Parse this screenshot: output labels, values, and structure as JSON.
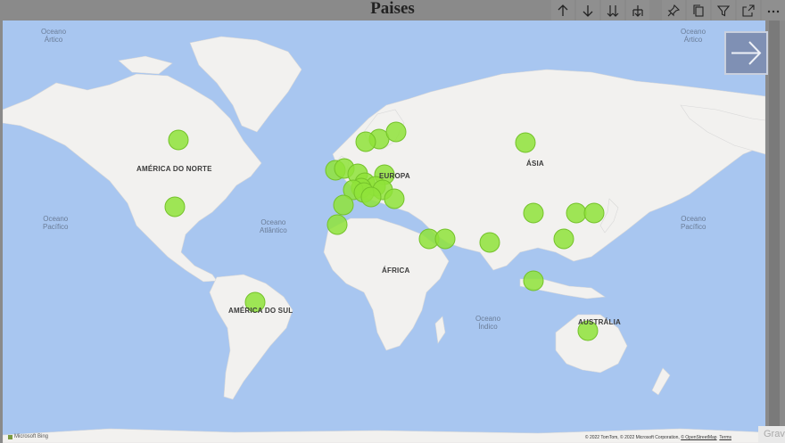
{
  "visual": {
    "title": "Paises"
  },
  "toolbar": {
    "icons": [
      "arrow-up-icon",
      "arrow-down-icon",
      "double-arrow-down-icon",
      "expand-hierarchy-icon",
      "pin-icon",
      "copy-icon",
      "filter-icon",
      "focus-mode-icon",
      "more-options-icon"
    ]
  },
  "map": {
    "oceans": {
      "arctic_left": "Oceano\nÁrtico",
      "arctic_right": "Oceano\nÁrtico",
      "pacific_left": "Oceano\nPacífico",
      "atlantic": "Oceano\nAtlântico",
      "indian": "Oceano\nÍndico",
      "pacific_right": "Oceano\nPacífico"
    },
    "continents": {
      "north_america": "AMÉRICA DO NORTE",
      "south_america": "AMÉRICA DO SUL",
      "europe": "EUROPA",
      "africa": "ÁFRICA",
      "asia": "ÁSIA",
      "australia": "AUSTRÁLIA"
    },
    "bubble_color": "#8fe33a",
    "land_color": "#f2f1ef",
    "water_color": "#a8c6f0",
    "attribution_prefix": "© 2022 TomTom, © 2022 Microsoft Corporation, ",
    "attribution_osm": "© OpenStreetMap",
    "attribution_terms": "Terms",
    "provider": "Microsoft Bing"
  },
  "corner_text": "Grav"
}
